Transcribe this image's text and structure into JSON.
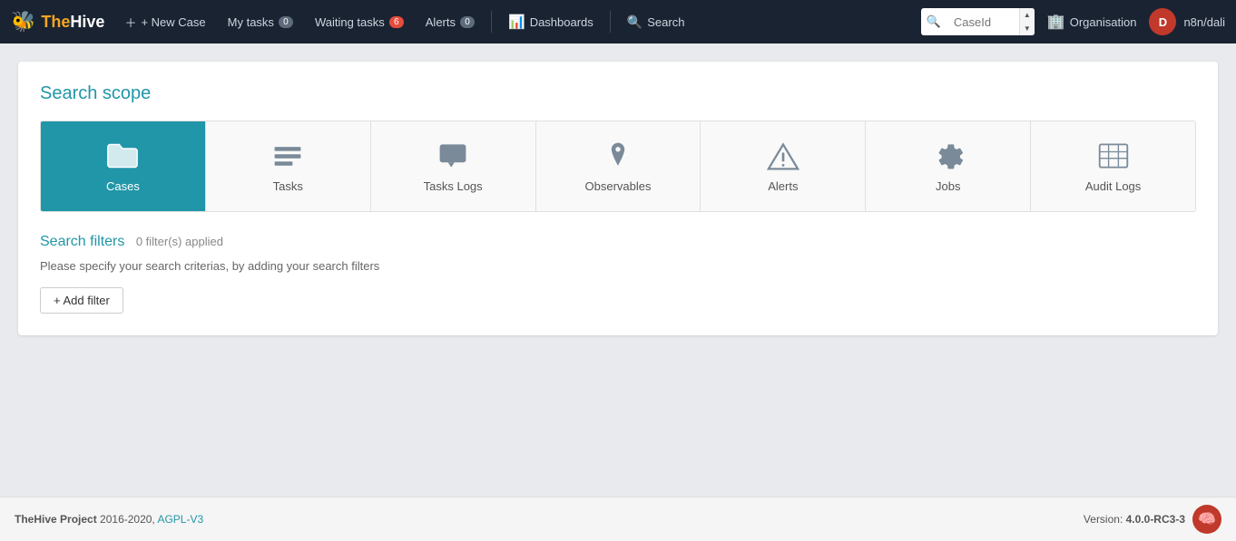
{
  "brand": {
    "the": "The",
    "hive": "Hive",
    "icon": "🐝"
  },
  "navbar": {
    "new_case_label": "+ New Case",
    "my_tasks_label": "My tasks",
    "my_tasks_badge": "0",
    "waiting_tasks_label": "Waiting tasks",
    "waiting_tasks_badge": "6",
    "alerts_label": "Alerts",
    "alerts_badge": "0",
    "dashboards_label": "Dashboards",
    "search_label": "Search",
    "search_placeholder": "CaseId",
    "org_label": "Organisation",
    "user_initial": "D",
    "user_name": "n8n/dali"
  },
  "page": {
    "search_scope_title": "Search scope",
    "tiles": [
      {
        "id": "cases",
        "label": "Cases",
        "icon": "folder",
        "active": true
      },
      {
        "id": "tasks",
        "label": "Tasks",
        "icon": "tasks",
        "active": false
      },
      {
        "id": "tasks-logs",
        "label": "Tasks Logs",
        "icon": "comment",
        "active": false
      },
      {
        "id": "observables",
        "label": "Observables",
        "icon": "pin",
        "active": false
      },
      {
        "id": "alerts",
        "label": "Alerts",
        "icon": "warning",
        "active": false
      },
      {
        "id": "jobs",
        "label": "Jobs",
        "icon": "gear",
        "active": false
      },
      {
        "id": "audit-logs",
        "label": "Audit Logs",
        "icon": "table",
        "active": false
      }
    ],
    "filters_title": "Search filters",
    "filters_applied": "0 filter(s) applied",
    "filters_hint": "Please specify your search criterias, by adding your search filters",
    "add_filter_label": "+ Add filter"
  },
  "footer": {
    "project_text": "TheHive Project",
    "years": "2016-2020,",
    "license": "AGPL-V3",
    "version_label": "Version:",
    "version": "4.0.0-RC3-3"
  },
  "colors": {
    "active_tile": "#2196a8",
    "brand_yellow": "#f5a623",
    "nav_bg": "#1a2332"
  }
}
